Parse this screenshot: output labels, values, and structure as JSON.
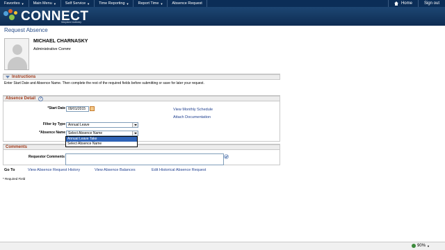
{
  "nav": {
    "items": [
      {
        "label": "Favorites",
        "caret": "▼"
      },
      {
        "label": "Main Menu",
        "caret": "▼"
      },
      {
        "label": "Self Service",
        "caret": "▼"
      },
      {
        "label": "Time Reporting",
        "caret": "▼"
      },
      {
        "label": "Report Time",
        "caret": "▼"
      },
      {
        "label": "Absence Request",
        "caret": ""
      }
    ],
    "home": "Home",
    "signout": "Sign out"
  },
  "banner": {
    "logo_text": "CONNECT",
    "logo_sub": "Maryland Judiciary"
  },
  "page": {
    "title": "Request Absence",
    "employee_name": "MICHAEL CHARNASKY",
    "employee_title": "Administrative Commr"
  },
  "instructions": {
    "header": "Instructions",
    "text": "Enter Start Date and Absence Name. Then complete the rest of the required fields before submitting or save for later your request."
  },
  "absence_detail": {
    "header": "Absence Detail",
    "help": "?",
    "start_date_label": "*Start Date",
    "start_date_value": "09/01/2015",
    "filter_label": "Filter by Type",
    "filter_value": "Annual Leave",
    "absence_name_label": "*Absence Name",
    "absence_name_value": "Select Absence Name",
    "dropdown_options": [
      "Annual Leave Take",
      "Select Absence Name"
    ],
    "link_schedule": "View Monthly Schedule",
    "link_attach": "Attach Documentation"
  },
  "comments": {
    "header": "Comments",
    "label": "Requestor Comments"
  },
  "goto": {
    "label": "Go To",
    "links": [
      "View Absence Request History",
      "View Absence Balances",
      "Edit Historical Absence Request"
    ]
  },
  "required_note": "* Required Field",
  "status": {
    "zoom": "90%"
  },
  "colors": {
    "nav_bg": "#0b2d57",
    "section_title": "#a03a1a",
    "link": "#1f3f8f",
    "selected_option": "#2f64b8"
  }
}
